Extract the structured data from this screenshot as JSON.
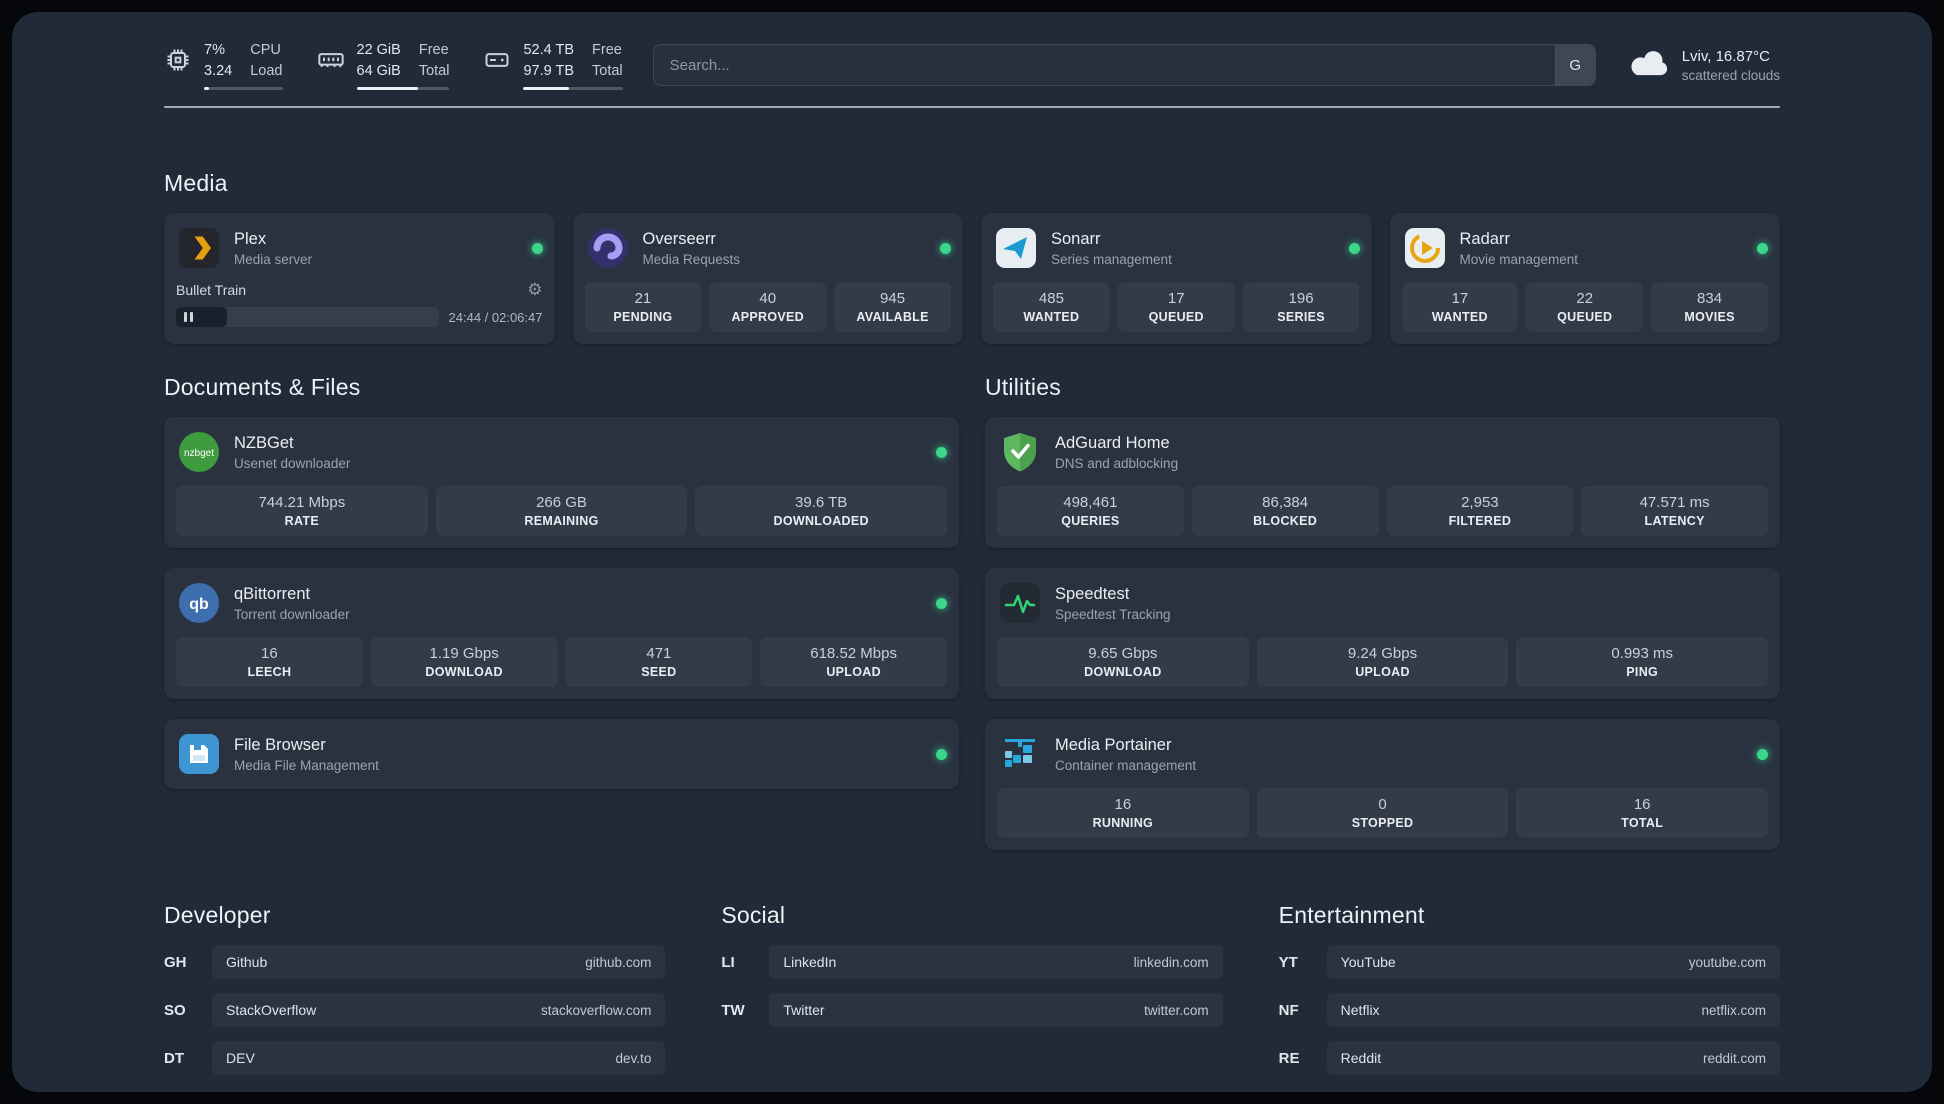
{
  "colors": {
    "status_online": "#3ad68b",
    "accent_plex": "#e5a00d",
    "accent_overseerr": "#a99df3",
    "accent_sonarr": "#1b9ad0",
    "accent_radarr": "#e7a512",
    "accent_nzbget": "#3e9c3e",
    "accent_qbittorrent": "#3d6fae",
    "accent_filebrowser": "#3d96d2",
    "accent_adguard": "#5fb760",
    "accent_speedtest": "#2fd573",
    "accent_portainer": "#29a8dc"
  },
  "topbar": {
    "resources": [
      {
        "icon": "cpu-icon",
        "value_top": "7%",
        "value_bottom": "3.24",
        "label_top": "CPU",
        "label_bottom": "Load",
        "progress": 7
      },
      {
        "icon": "memory-icon",
        "value_top": "22 GiB",
        "value_bottom": "64 GiB",
        "label_top": "Free",
        "label_bottom": "Total",
        "progress": 66
      },
      {
        "icon": "disk-icon",
        "value_top": "52.4 TB",
        "value_bottom": "97.9 TB",
        "label_top": "Free",
        "label_bottom": "Total",
        "progress": 46
      }
    ],
    "search": {
      "placeholder": "Search...",
      "provider_button": "G"
    },
    "weather": {
      "location": "Lviv, 16.87°C",
      "condition": "scattered clouds"
    }
  },
  "sections": {
    "media": {
      "title": "Media",
      "services": [
        {
          "name": "Plex",
          "desc": "Media server",
          "status": "online",
          "player": {
            "track": "Bullet Train",
            "time": "24:44 / 02:06:47",
            "progress_pct": 19.5
          }
        },
        {
          "name": "Overseerr",
          "desc": "Media Requests",
          "status": "online",
          "stats": [
            {
              "value": "21",
              "label": "PENDING"
            },
            {
              "value": "40",
              "label": "APPROVED"
            },
            {
              "value": "945",
              "label": "AVAILABLE"
            }
          ]
        },
        {
          "name": "Sonarr",
          "desc": "Series management",
          "status": "online",
          "stats": [
            {
              "value": "485",
              "label": "WANTED"
            },
            {
              "value": "17",
              "label": "QUEUED"
            },
            {
              "value": "196",
              "label": "SERIES"
            }
          ]
        },
        {
          "name": "Radarr",
          "desc": "Movie management",
          "status": "online",
          "stats": [
            {
              "value": "17",
              "label": "WANTED"
            },
            {
              "value": "22",
              "label": "QUEUED"
            },
            {
              "value": "834",
              "label": "MOVIES"
            }
          ]
        }
      ]
    },
    "documents": {
      "title": "Documents & Files",
      "services": [
        {
          "name": "NZBGet",
          "desc": "Usenet downloader",
          "status": "online",
          "icon_text": "nzbget",
          "stats": [
            {
              "value": "744.21 Mbps",
              "label": "RATE"
            },
            {
              "value": "266 GB",
              "label": "REMAINING"
            },
            {
              "value": "39.6 TB",
              "label": "DOWNLOADED"
            }
          ]
        },
        {
          "name": "qBittorrent",
          "desc": "Torrent downloader",
          "status": "online",
          "icon_text": "qb",
          "stats": [
            {
              "value": "16",
              "label": "LEECH"
            },
            {
              "value": "1.19 Gbps",
              "label": "DOWNLOAD"
            },
            {
              "value": "471",
              "label": "SEED"
            },
            {
              "value": "618.52 Mbps",
              "label": "UPLOAD"
            }
          ]
        },
        {
          "name": "File Browser",
          "desc": "Media File Management",
          "status": "online"
        }
      ]
    },
    "utilities": {
      "title": "Utilities",
      "services": [
        {
          "name": "AdGuard Home",
          "desc": "DNS and adblocking",
          "stats": [
            {
              "value": "498,461",
              "label": "QUERIES"
            },
            {
              "value": "86,384",
              "label": "BLOCKED"
            },
            {
              "value": "2,953",
              "label": "FILTERED"
            },
            {
              "value": "47.571 ms",
              "label": "LATENCY"
            }
          ]
        },
        {
          "name": "Speedtest",
          "desc": "Speedtest Tracking",
          "stats": [
            {
              "value": "9.65 Gbps",
              "label": "DOWNLOAD"
            },
            {
              "value": "9.24 Gbps",
              "label": "UPLOAD"
            },
            {
              "value": "0.993 ms",
              "label": "PING"
            }
          ]
        },
        {
          "name": "Media Portainer",
          "desc": "Container management",
          "status": "online",
          "stats": [
            {
              "value": "16",
              "label": "RUNNING"
            },
            {
              "value": "0",
              "label": "STOPPED"
            },
            {
              "value": "16",
              "label": "TOTAL"
            }
          ]
        }
      ]
    }
  },
  "bookmarks": [
    {
      "title": "Developer",
      "items": [
        {
          "abbr": "GH",
          "name": "Github",
          "url": "github.com"
        },
        {
          "abbr": "SO",
          "name": "StackOverflow",
          "url": "stackoverflow.com"
        },
        {
          "abbr": "DT",
          "name": "DEV",
          "url": "dev.to"
        }
      ]
    },
    {
      "title": "Social",
      "items": [
        {
          "abbr": "LI",
          "name": "LinkedIn",
          "url": "linkedin.com"
        },
        {
          "abbr": "TW",
          "name": "Twitter",
          "url": "twitter.com"
        }
      ]
    },
    {
      "title": "Entertainment",
      "items": [
        {
          "abbr": "YT",
          "name": "YouTube",
          "url": "youtube.com"
        },
        {
          "abbr": "NF",
          "name": "Netflix",
          "url": "netflix.com"
        },
        {
          "abbr": "RE",
          "name": "Reddit",
          "url": "reddit.com"
        }
      ]
    }
  ]
}
